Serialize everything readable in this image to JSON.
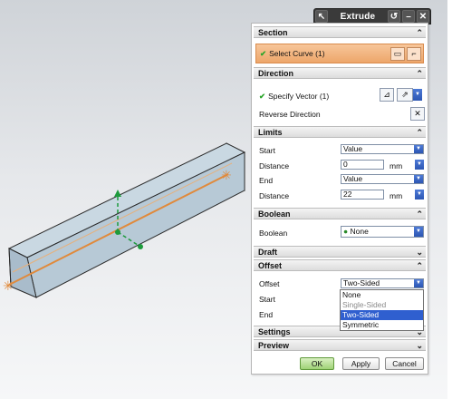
{
  "title": "Extrude",
  "titlebar_icons": [
    "cursor-icon",
    "reset-icon",
    "minimize-icon",
    "close-icon"
  ],
  "sections": {
    "section": {
      "header": "Section",
      "select_curve": "Select Curve (1)"
    },
    "direction": {
      "header": "Direction",
      "specify_vector": "Specify Vector (1)",
      "reverse_direction": "Reverse Direction"
    },
    "limits": {
      "header": "Limits",
      "start_label": "Start",
      "start_value": "Value",
      "start_distance_label": "Distance",
      "start_distance": "0",
      "start_unit": "mm",
      "end_label": "End",
      "end_value": "Value",
      "end_distance_label": "Distance",
      "end_distance": "22",
      "end_unit": "mm"
    },
    "boolean": {
      "header": "Boolean",
      "label": "Boolean",
      "value": "None"
    },
    "draft": {
      "header": "Draft"
    },
    "offset": {
      "header": "Offset",
      "label": "Offset",
      "value": "Two-Sided",
      "start_label": "Start",
      "end_label": "End",
      "options": [
        "None",
        "Single-Sided",
        "Two-Sided",
        "Symmetric"
      ],
      "selected_option": "Two-Sided",
      "disabled_option": "Single-Sided"
    },
    "settings": {
      "header": "Settings"
    },
    "preview": {
      "header": "Preview"
    }
  },
  "buttons": {
    "ok": "OK",
    "apply": "Apply",
    "cancel": "Cancel"
  },
  "colors": {
    "section_highlight": "#eda66a",
    "check_green": "#2aa52a",
    "dropdown_selected": "#2f5fcf",
    "ok_green": "#9fd276",
    "curve_orange": "#e08a3c",
    "vector_green": "#1e9a3c"
  }
}
